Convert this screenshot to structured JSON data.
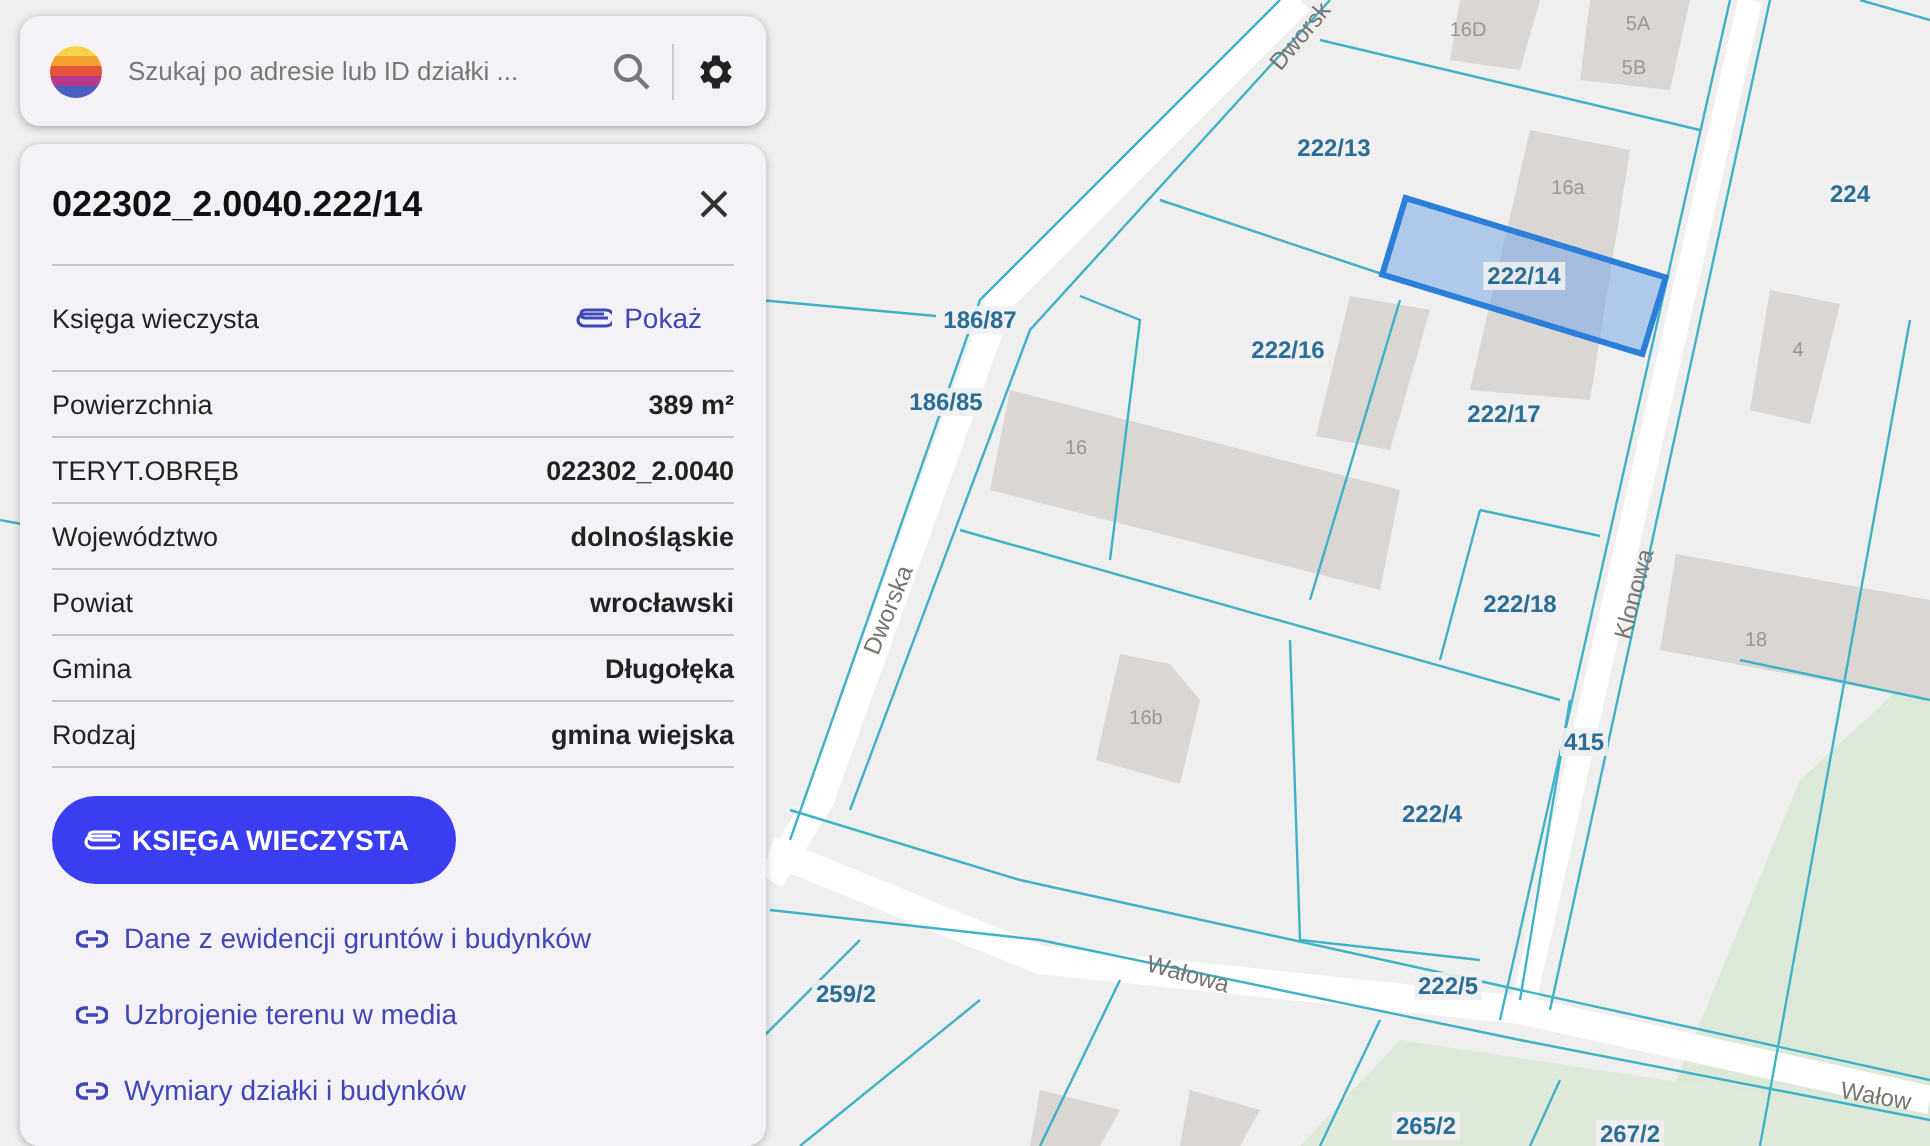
{
  "search": {
    "placeholder": "Szukaj po adresie lub ID działki ..."
  },
  "panel": {
    "title": "022302_2.0040.222/14",
    "rows": [
      {
        "kind": "link",
        "label": "Księga wieczysta",
        "value": "Pokaż"
      },
      {
        "kind": "text",
        "label": "Powierzchnia",
        "value": "389 m²"
      },
      {
        "kind": "text",
        "label": "TERYT.OBRĘB",
        "value": "022302_2.0040"
      },
      {
        "kind": "text",
        "label": "Województwo",
        "value": "dolnośląskie"
      },
      {
        "kind": "text",
        "label": "Powiat",
        "value": "wrocławski"
      },
      {
        "kind": "text",
        "label": "Gmina",
        "value": "Długołęka"
      },
      {
        "kind": "text",
        "label": "Rodzaj",
        "value": "gmina wiejska"
      }
    ],
    "primary_button": "KSIĘGA WIECZYSTA",
    "links": [
      "Dane z ewidencji gruntów i budynków",
      "Uzbrojenie terenu w media",
      "Wymiary działki i budynków"
    ]
  },
  "map": {
    "parcels": [
      {
        "label": "222/13",
        "selected": false
      },
      {
        "label": "224",
        "selected": false
      },
      {
        "label": "222/14",
        "selected": true
      },
      {
        "label": "186/87",
        "selected": false
      },
      {
        "label": "222/16",
        "selected": false
      },
      {
        "label": "186/85",
        "selected": false
      },
      {
        "label": "222/17",
        "selected": false
      },
      {
        "label": "222/18",
        "selected": false
      },
      {
        "label": "415",
        "selected": false
      },
      {
        "label": "222/4",
        "selected": false
      },
      {
        "label": "259/2",
        "selected": false
      },
      {
        "label": "222/5",
        "selected": false
      },
      {
        "label": "265/2",
        "selected": false
      },
      {
        "label": "267/2",
        "selected": false
      }
    ],
    "streets": [
      "Dworsk",
      "Dworska",
      "Klonowa",
      "Wałowa",
      "Wałow"
    ],
    "buildings": [
      "16D",
      "5A",
      "5B",
      "16a",
      "4",
      "16",
      "16b",
      "18"
    ]
  }
}
